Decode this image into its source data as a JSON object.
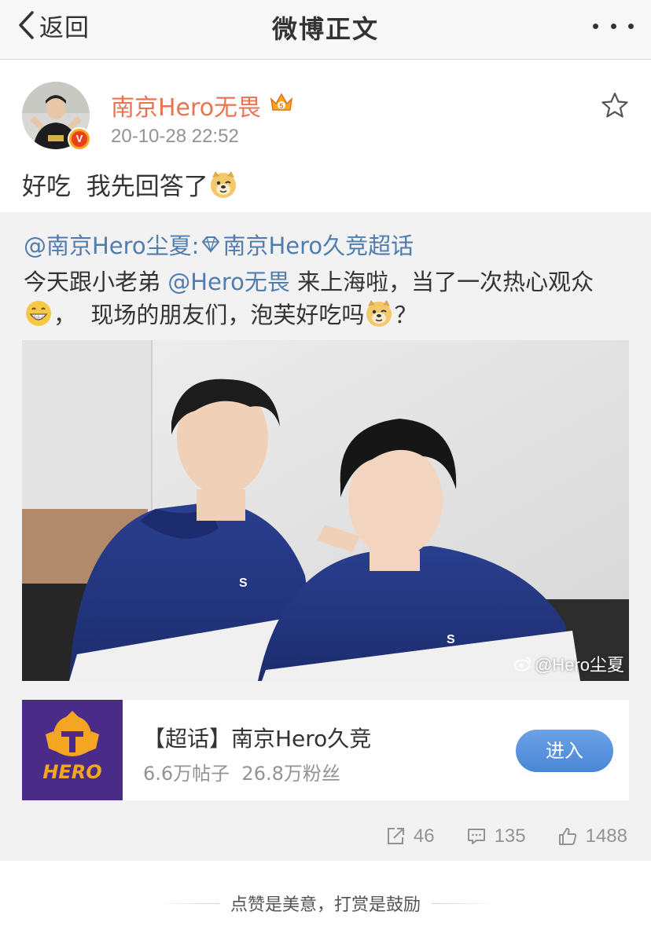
{
  "navbar": {
    "back_label": "返回",
    "title": "微博正文"
  },
  "post": {
    "username": "南京Hero无畏",
    "timestamp": "20-10-28 22:52",
    "text": "好吃  我先回答了"
  },
  "repost": {
    "author_mention": "@南京Hero尘夏:",
    "topic_link": "南京Hero久竞超话",
    "line2_before": "今天跟小老弟 ",
    "line2_mention": "@Hero无畏",
    "line2_after": " 来上海啦，当了一次热心观众",
    "line3_before": "，  现场的朋友们，泡芙好吃吗",
    "line3_after": "？",
    "image_watermark": "@Hero尘夏"
  },
  "topic_card": {
    "title": "【超话】南京Hero久竞",
    "stats": "6.6万帖子  26.8万粉丝",
    "enter_label": "进入",
    "logo_text": "HERO"
  },
  "actions": {
    "repost_count": "46",
    "comment_count": "135",
    "like_count": "1488"
  },
  "footer": {
    "tip": "点赞是美意，打赏是鼓励"
  },
  "colors": {
    "username": "#eb7350",
    "link": "#507daf",
    "enter_button": "#5a93de",
    "repost_background": "#f2f2f2",
    "topic_logo_background": "#4a2c88"
  },
  "icons": {
    "back": "chevron-left-icon",
    "more": "more-dots-icon",
    "favorite": "star-icon",
    "verified": "verified-v-icon",
    "crown": "crown-member-icon",
    "repost": "repost-icon",
    "comment": "comment-icon",
    "like": "thumbs-up-icon"
  }
}
